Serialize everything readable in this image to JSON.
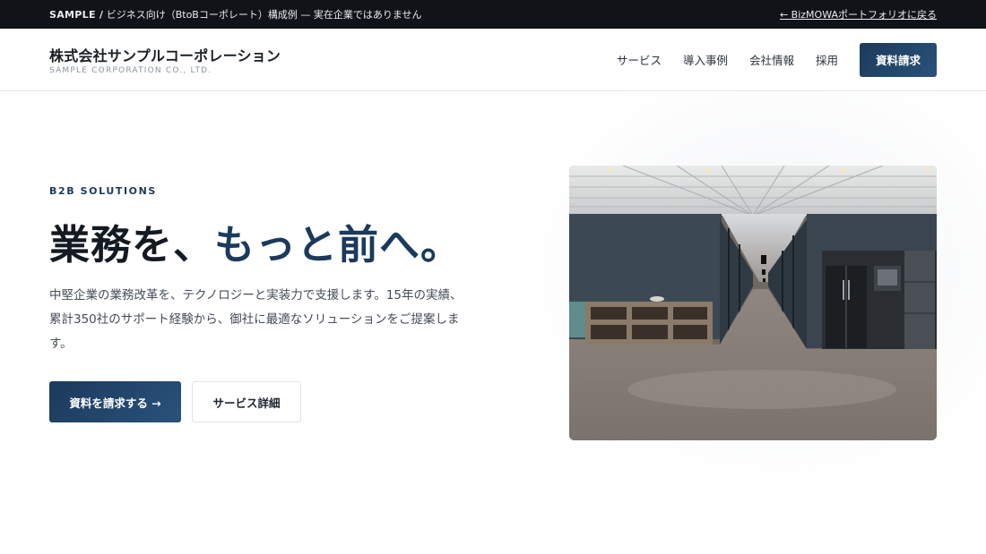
{
  "topbar": {
    "sample_tag": "SAMPLE /",
    "notice": "ビジネス向け（BtoBコーポレート）構成例 — 実在企業ではありません",
    "back_link": "← BizMOWAポートフォリオに戻る"
  },
  "header": {
    "company_name": "株式会社サンプルコーポレーション",
    "company_en": "SAMPLE CORPORATION CO., LTD.",
    "nav": [
      "サービス",
      "導入事例",
      "会社情報",
      "採用"
    ],
    "cta": "資料請求"
  },
  "hero": {
    "eyebrow": "B2B SOLUTIONS",
    "headline_a": "業務を、",
    "headline_b": "もっと前へ。",
    "lead": "中堅企業の業務改革を、テクノロジーと実装力で支援します。15年の実績、累計350社のサポート経験から、御社に最適なソリューションをご提案します。",
    "primary_button": "資料を請求する →",
    "secondary_button": "サービス詳細"
  },
  "colors": {
    "accent": "#1b3a5c",
    "topbar_bg": "#101418"
  }
}
